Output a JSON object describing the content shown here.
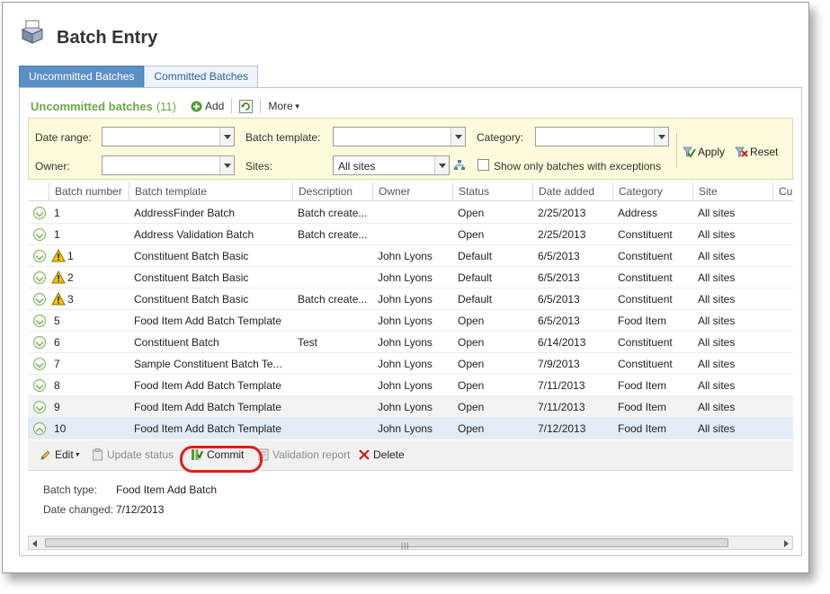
{
  "header": {
    "title": "Batch Entry",
    "icon": "batch-stack-icon"
  },
  "tabs": [
    {
      "label": "Uncommitted Batches",
      "active": true
    },
    {
      "label": "Committed Batches",
      "active": false
    }
  ],
  "panel": {
    "title": "Uncommitted batches",
    "count": "(11)",
    "add_label": "Add",
    "more_label": "More"
  },
  "filters": {
    "date_range_label": "Date range:",
    "date_range_value": "",
    "batch_template_label": "Batch template:",
    "batch_template_value": "",
    "category_label": "Category:",
    "category_value": "",
    "owner_label": "Owner:",
    "owner_value": "",
    "sites_label": "Sites:",
    "sites_value": "All sites",
    "exceptions_label": "Show only batches with exceptions",
    "exceptions_checked": false,
    "apply_label": "Apply",
    "reset_label": "Reset"
  },
  "grid": {
    "columns": [
      "Batch number",
      "Batch template",
      "Description",
      "Owner",
      "Status",
      "Date added",
      "Category",
      "Site",
      "Cu"
    ],
    "rows": [
      {
        "number": "1",
        "template": "AddressFinder Batch",
        "description": "Batch create...",
        "owner": "",
        "status": "Open",
        "date": "2/25/2013",
        "category": "Address",
        "site": "All sites",
        "warning": false
      },
      {
        "number": "1",
        "template": "Address Validation Batch",
        "description": "Batch create...",
        "owner": "",
        "status": "Open",
        "date": "2/25/2013",
        "category": "Constituent",
        "site": "All sites",
        "warning": false
      },
      {
        "number": "1",
        "template": "Constituent Batch Basic",
        "description": "",
        "owner": "John Lyons",
        "status": "Default",
        "date": "6/5/2013",
        "category": "Constituent",
        "site": "All sites",
        "warning": true
      },
      {
        "number": "2",
        "template": "Constituent Batch Basic",
        "description": "",
        "owner": "John Lyons",
        "status": "Default",
        "date": "6/5/2013",
        "category": "Constituent",
        "site": "All sites",
        "warning": true
      },
      {
        "number": "3",
        "template": "Constituent Batch Basic",
        "description": "Batch create...",
        "owner": "John Lyons",
        "status": "Default",
        "date": "6/5/2013",
        "category": "Constituent",
        "site": "All sites",
        "warning": true
      },
      {
        "number": "5",
        "template": "Food Item Add Batch Template",
        "description": "",
        "owner": "John Lyons",
        "status": "Open",
        "date": "6/5/2013",
        "category": "Food Item",
        "site": "All sites",
        "warning": false
      },
      {
        "number": "6",
        "template": "Constituent Batch",
        "description": "Test",
        "owner": "John Lyons",
        "status": "Open",
        "date": "6/14/2013",
        "category": "Constituent",
        "site": "All sites",
        "warning": false
      },
      {
        "number": "7",
        "template": "Sample Constituent Batch Te...",
        "description": "",
        "owner": "John Lyons",
        "status": "Open",
        "date": "7/9/2013",
        "category": "Constituent",
        "site": "All sites",
        "warning": false
      },
      {
        "number": "8",
        "template": "Food Item Add Batch Template",
        "description": "",
        "owner": "John Lyons",
        "status": "Open",
        "date": "7/11/2013",
        "category": "Food Item",
        "site": "All sites",
        "warning": false
      },
      {
        "number": "9",
        "template": "Food Item Add Batch Template",
        "description": "",
        "owner": "John Lyons",
        "status": "Open",
        "date": "7/11/2013",
        "category": "Food Item",
        "site": "All sites",
        "warning": false
      },
      {
        "number": "10",
        "template": "Food Item Add Batch Template",
        "description": "",
        "owner": "John Lyons",
        "status": "Open",
        "date": "7/12/2013",
        "category": "Food Item",
        "site": "All sites",
        "warning": false
      }
    ]
  },
  "actions": {
    "edit": "Edit",
    "update_status": "Update status",
    "commit": "Commit",
    "validation_report": "Validation report",
    "delete": "Delete"
  },
  "details": {
    "batch_type_label": "Batch type:",
    "batch_type_value": "Food Item Add Batch",
    "date_changed_label": "Date changed:",
    "date_changed_value": "7/12/2013"
  },
  "colors": {
    "accent_green": "#69a845",
    "tab_blue": "#5b8fc5",
    "filter_bg": "#fdfbdc",
    "selected_row": "#e2ecf7",
    "highlight_red": "#e01b1b"
  }
}
